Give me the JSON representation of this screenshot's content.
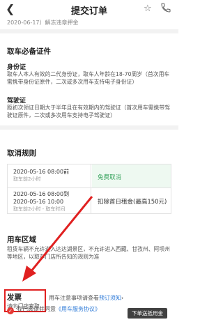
{
  "nav": {
    "back_icon": "back-chevron-icon",
    "title": "提交订单",
    "star_icon": "star-icon",
    "phone_icon": "phone-icon"
  },
  "subbar": {
    "text": "2020-06-17）解冻违章押金"
  },
  "documents": {
    "title": "取车必备证件",
    "id_title": "身份证",
    "id_text": "取车人本人有效的二代身份证，取车人年龄在18-70周岁（首次用车需携带身份证原件，二次或多次用车支持电子身份证）",
    "license_title": "驾驶证",
    "license_text": "距初次领证日期大于半年且在有效期内的驾驶证（首次用车需携带驾驶证原件，二次或多次用车支持电子驾驶证）"
  },
  "cancel": {
    "title": "取消规则",
    "rows": [
      {
        "time": "2020-05-16 08:00前",
        "note": "取车前2小时",
        "rule": "免费取消"
      },
      {
        "time": "2020-05-16 08:00到",
        "time2": "2020-05-16 10:00",
        "note": "取车前2小时 - 取车时间",
        "rule": "扣除首日租金(最高150元)"
      }
    ]
  },
  "area": {
    "title": "用车区域",
    "text": "租赁车辆不允许进入达达湖景区，不允许进入西藏、甘孜州、阿坝州等地区，以取车门店所告知的规则为准"
  },
  "invoice": {
    "title": "发票",
    "text": "请向门店索取"
  },
  "notice": {
    "text": "用车注意事项请查看",
    "link": "预订须知",
    "chevron": "›"
  },
  "agree": {
    "text": "我已阅读并同意",
    "link": "《用车服务协议》"
  },
  "tooltip": {
    "text": "下单送抵用金"
  },
  "colors": {
    "accent": "#e53935",
    "free": "#37a35d",
    "link": "#2f7bd8",
    "arrow": "#e02020"
  }
}
